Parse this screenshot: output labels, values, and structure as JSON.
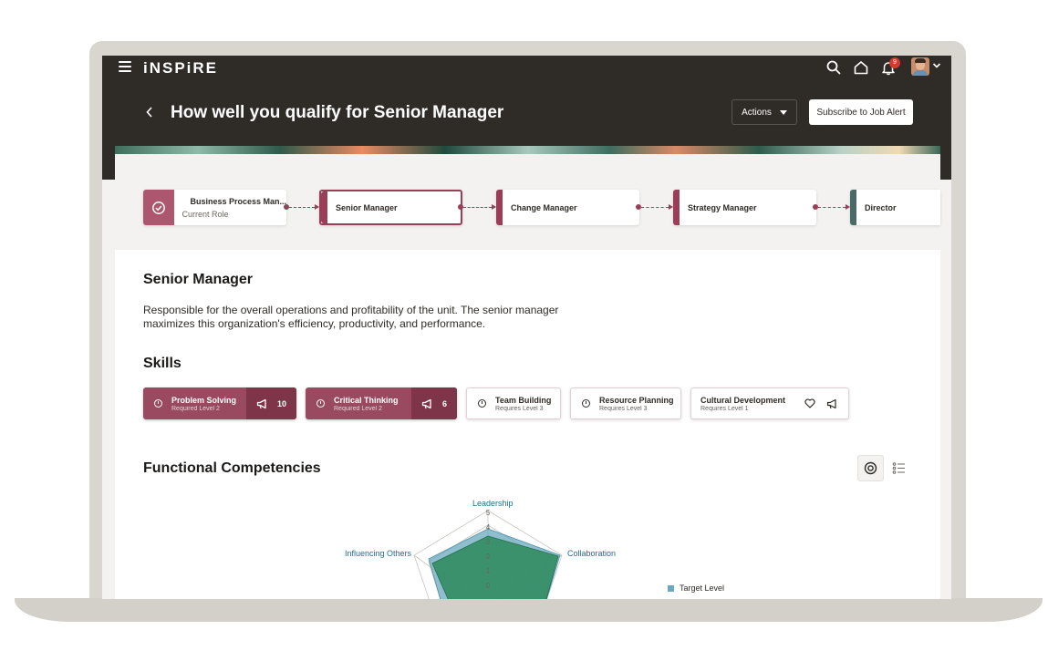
{
  "app": {
    "logo": "iNSPiRE",
    "notification_count": "9"
  },
  "header": {
    "title": "How well you qualify for Senior Manager",
    "actions_label": "Actions",
    "subscribe_label": "Subscribe to Job Alert"
  },
  "career_path": {
    "current": {
      "title": "Business Process Man...",
      "subtitle": "Current Role"
    },
    "roles": [
      {
        "title": "Senior Manager",
        "color": "#9a3d57"
      },
      {
        "title": "Change Manager",
        "color": "#9a3d57"
      },
      {
        "title": "Strategy Manager",
        "color": "#9a3d57"
      },
      {
        "title": "Director",
        "color": "#4a6b65"
      }
    ]
  },
  "role_detail": {
    "title": "Senior Manager",
    "description": "Responsible for the overall operations and profitability of the unit. The senior manager maximizes this organization's efficiency, productivity, and performance."
  },
  "skills": {
    "heading": "Skills",
    "items": [
      {
        "name": "Problem Solving",
        "requirement": "Required Level 2",
        "count": "10",
        "style": "filled"
      },
      {
        "name": "Critical Thinking",
        "requirement": "Required Level 2",
        "count": "6",
        "style": "filled"
      },
      {
        "name": "Team Building",
        "requirement": "Requires Level 3",
        "style": "outlined"
      },
      {
        "name": "Resource Planning",
        "requirement": "Requires Level 3",
        "style": "outlined"
      },
      {
        "name": "Cultural Development",
        "requirement": "Requires Level 1",
        "style": "outlined"
      }
    ]
  },
  "competencies": {
    "heading": "Functional Competencies",
    "chart_data": {
      "type": "radar",
      "axes": [
        "Leadership",
        "Collaboration",
        "Influencing Others"
      ],
      "scale_ticks": [
        "5",
        "4",
        "3",
        "2",
        "1",
        "0"
      ],
      "legend": [
        "Target Level"
      ],
      "colors": {
        "target": "#6aa8bf",
        "current": "#2e8a5c"
      }
    }
  },
  "colors": {
    "accent": "#9a3d57",
    "header_bg": "#2f2b27"
  }
}
